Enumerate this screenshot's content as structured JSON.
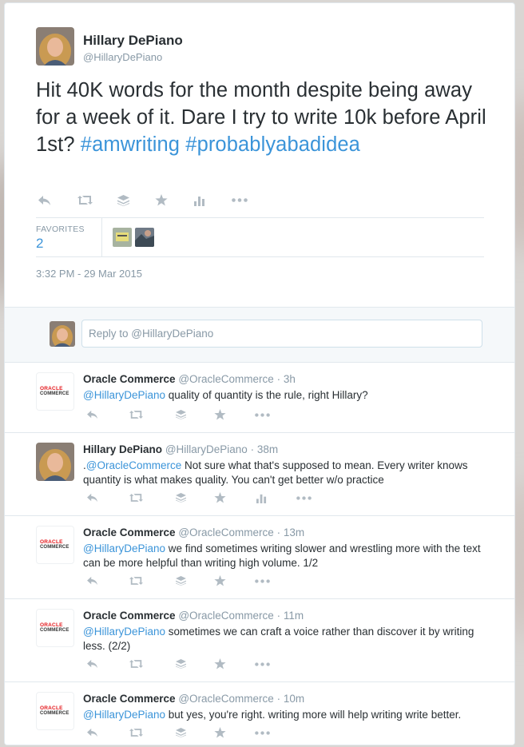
{
  "tweet": {
    "author_name": "Hillary DePiano",
    "author_handle": "@HillaryDePiano",
    "text_main": "Hit 40K words for the month despite being away for a week of it. Dare I try to write 10k before April 1st?",
    "hashtag_1": "#amwriting",
    "hashtag_2": "#probablyabadidea",
    "favorites_label": "FAVORITES",
    "favorites_count": "2",
    "timestamp": "3:32 PM - 29 Mar 2015"
  },
  "reply_box": {
    "placeholder": "Reply to @HillaryDePiano"
  },
  "logo": {
    "line1": "ORACLE",
    "line2": "COMMERCE"
  },
  "replies": [
    {
      "name": "Oracle Commerce",
      "handle": "@OracleCommerce",
      "time": "3h",
      "mention": "@HillaryDePiano",
      "text": " quality of quantity is the rule, right Hillary?"
    },
    {
      "name": "Hillary DePiano",
      "handle": "@HillaryDePiano",
      "time": "38m",
      "prefix": ".",
      "mention": "@OracleCommerce",
      "text": " Not sure what that's supposed to mean. Every writer knows quantity is what makes quality. You can't get better w/o practice"
    },
    {
      "name": "Oracle Commerce",
      "handle": "@OracleCommerce",
      "time": "13m",
      "mention": "@HillaryDePiano",
      "text": " we find sometimes writing slower and wrestling more with the text can be more helpful than writing high volume. 1/2"
    },
    {
      "name": "Oracle Commerce",
      "handle": "@OracleCommerce",
      "time": "11m",
      "mention": "@HillaryDePiano",
      "text": " sometimes we can craft a voice rather than discover it by writing less. (2/2)"
    },
    {
      "name": "Oracle Commerce",
      "handle": "@OracleCommerce",
      "time": "10m",
      "mention": "@HillaryDePiano",
      "text": " but yes, you're right. writing more will help writing write better."
    }
  ],
  "separator": " · ",
  "colors": {
    "link": "#3b94d9",
    "muted": "#8899a6",
    "icon": "#b1bbc3",
    "text": "#292f33",
    "oracle_red": "#e3171b"
  },
  "icons": [
    "reply-icon",
    "retweet-icon",
    "stack-icon",
    "favorite-star-icon",
    "stats-icon",
    "more-icon"
  ]
}
